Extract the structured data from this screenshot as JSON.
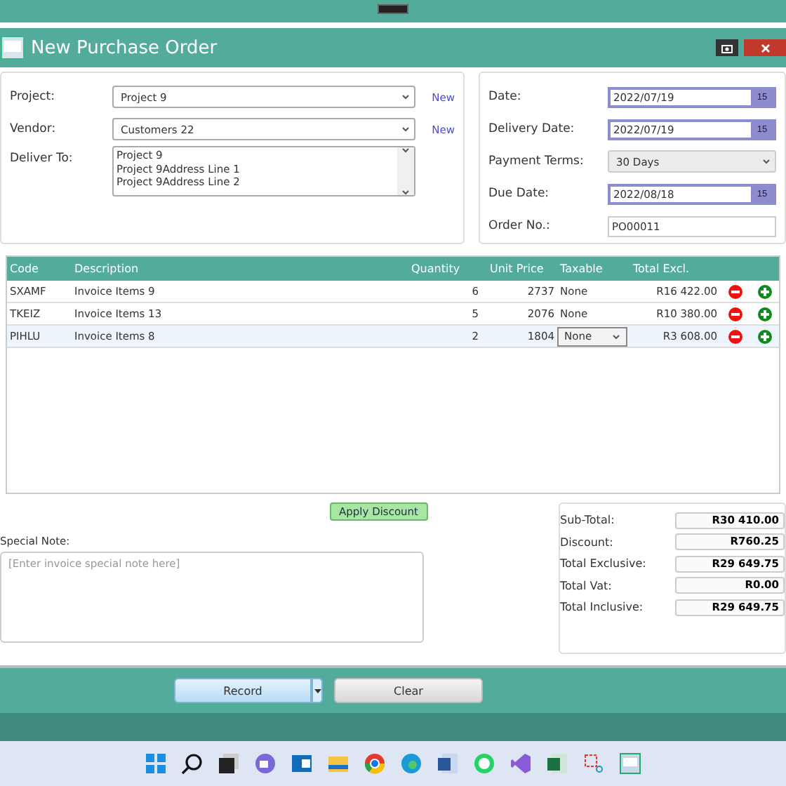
{
  "window": {
    "title": "New Purchase Order"
  },
  "left_form": {
    "project": {
      "label": "Project:",
      "value": "Project 9",
      "link": "New"
    },
    "vendor": {
      "label": "Vendor:",
      "value": "Customers 22",
      "link": "New"
    },
    "deliver_to": {
      "label": "Deliver To:",
      "lines": [
        "Project 9",
        "Project 9Address Line 1",
        "Project 9Address Line 2"
      ]
    }
  },
  "right_form": [
    {
      "kind": "date",
      "label": "Date:",
      "value": "2022/07/19",
      "button": "15"
    },
    {
      "kind": "date",
      "label": "Delivery Date:",
      "value": "2022/07/19",
      "button": "15"
    },
    {
      "kind": "combo",
      "label": "Payment Terms:",
      "value": "30 Days"
    },
    {
      "kind": "date",
      "label": "Due Date:",
      "value": "2022/08/18",
      "button": "15"
    },
    {
      "kind": "text",
      "label": "Order No.:",
      "value": "PO00011"
    }
  ],
  "table": {
    "columns": [
      "Code",
      "Description",
      "Quantity",
      "Unit Price",
      "Taxable",
      "Total Excl."
    ],
    "rows": [
      {
        "code": "SXAMF",
        "description": "Invoice Items  9",
        "quantity": "6",
        "unit_price": "2737",
        "taxable": "None",
        "total": "R16 422.00",
        "selected": false
      },
      {
        "code": "TKEIZ",
        "description": "Invoice Items  13",
        "quantity": "5",
        "unit_price": "2076",
        "taxable": "None",
        "total": "R10 380.00",
        "selected": false
      },
      {
        "code": "PIHLU",
        "description": "Invoice Items  8",
        "quantity": "2",
        "unit_price": "1804",
        "taxable": "None",
        "total": "R3 608.00",
        "selected": true
      }
    ]
  },
  "apply_discount": "Apply Discount",
  "special_note": {
    "label": "Special Note:",
    "placeholder": "[Enter invoice special note here]"
  },
  "totals": [
    {
      "label": "Sub-Total:",
      "value": "R30 410.00"
    },
    {
      "label": "Discount:",
      "value": "R760.25"
    },
    {
      "label": "Total Exclusive:",
      "value": "R29 649.75"
    },
    {
      "label": "Total Vat:",
      "value": "R0.00"
    },
    {
      "label": "Total Inclusive:",
      "value": "R29 649.75"
    }
  ],
  "buttons": {
    "record": "Record",
    "clear": "Clear"
  }
}
